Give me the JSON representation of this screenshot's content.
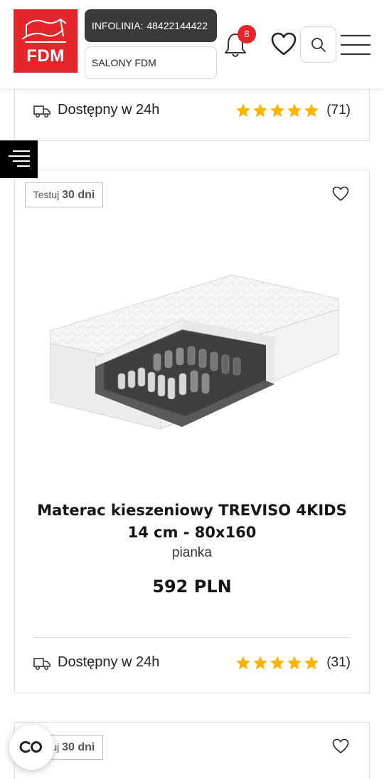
{
  "header": {
    "logo_text": "FDM",
    "infolinia_label": "INFOLINIA:",
    "infolinia_number": "48422144422",
    "salony_label": "SALONY FDM",
    "notification_count": "8"
  },
  "icons": {
    "bell": "bell-icon",
    "heart": "heart-icon",
    "search": "search-icon",
    "menu": "hamburger-menu-icon",
    "truck": "delivery-truck-icon",
    "star": "star-icon",
    "filter": "filter-menu-icon",
    "cookie": "cookie-settings-icon"
  },
  "colors": {
    "brand_red": "#e4262b",
    "star_yellow": "#f7b500",
    "dark": "#3a3a3a"
  },
  "prev_card": {
    "availability": "Dostępny w 24h",
    "rating_stars": 5,
    "review_count": "(71)"
  },
  "product": {
    "badge_prefix": "Testuj",
    "badge_days": "30 dni",
    "title": "Materac kieszeniowy TREVISO 4KIDS 14 cm - 80x160",
    "subtitle": "pianka",
    "price": "592 PLN",
    "availability": "Dostępny w 24h",
    "rating_stars": 5,
    "review_count": "(31)"
  },
  "next_card": {
    "badge_prefix": "Testuj",
    "badge_days": "30 dni"
  }
}
